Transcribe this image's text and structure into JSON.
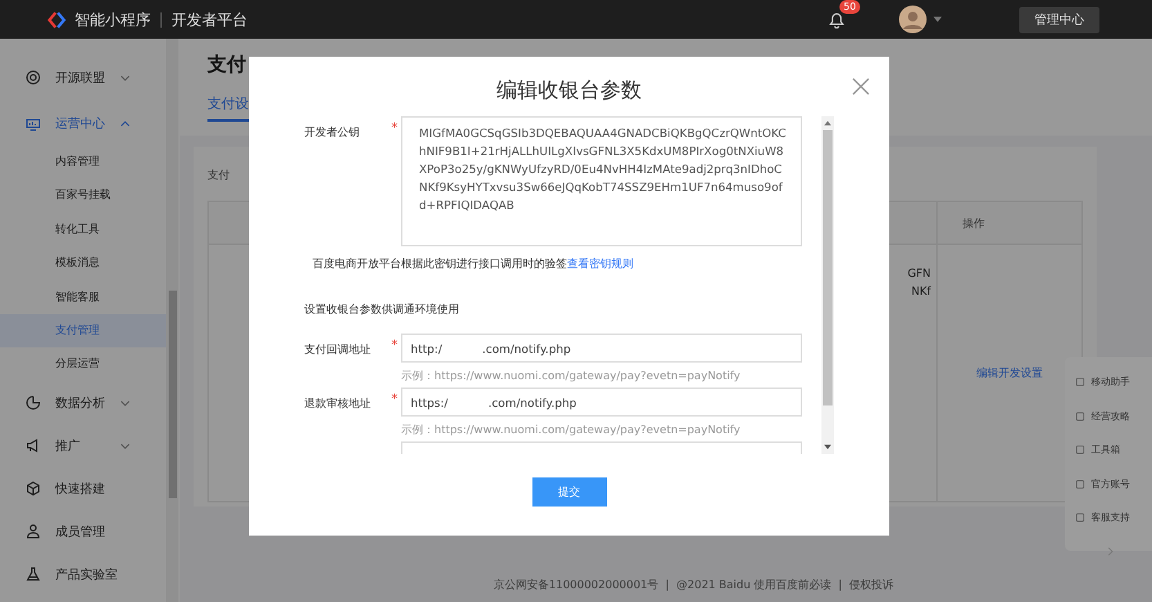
{
  "topbar": {
    "logo_text": "智能小程序",
    "platform": "开发者平台",
    "notification_badge": "50",
    "admin_button": "管理中心"
  },
  "sidebar": {
    "items": [
      {
        "label": "开源联盟",
        "expanded": false,
        "selected": false
      },
      {
        "label": "运营中心",
        "expanded": true,
        "selected": true,
        "children": [
          {
            "label": "内容管理",
            "selected": false
          },
          {
            "label": "百家号挂载",
            "selected": false
          },
          {
            "label": "转化工具",
            "selected": false
          },
          {
            "label": "模板消息",
            "selected": false
          },
          {
            "label": "智能客服",
            "selected": false
          },
          {
            "label": "支付管理",
            "selected": true
          },
          {
            "label": "分层运营",
            "selected": false
          }
        ]
      },
      {
        "label": "数据分析",
        "expanded": false,
        "selected": false
      },
      {
        "label": "推广",
        "expanded": false,
        "selected": false
      },
      {
        "label": "快速搭建",
        "selected": false
      },
      {
        "label": "成员管理",
        "selected": false
      },
      {
        "label": "产品实验室",
        "selected": false
      }
    ]
  },
  "main": {
    "title": "支付",
    "tab": "支付设",
    "section_label": "支付",
    "table": {
      "header": "操作",
      "fragment_lines": [
        "GFN",
        "NKf"
      ],
      "action_link": "编辑开发设置"
    }
  },
  "side_panel": {
    "items": [
      "移动助手",
      "经营攻略",
      "工具箱",
      "官方账号",
      "客服支持"
    ]
  },
  "footer": "京公网安备11000002000001号  |  @2021 Baidu 使用百度前必读  |  侵权投诉",
  "modal": {
    "title": "编辑收银台参数",
    "submit": "提交",
    "items": [
      {
        "kind": "textarea",
        "label": "开发者公钥",
        "required_mark": "*",
        "value": "MIGfMA0GCSqGSIb3DQEBAQUAA4GNADCBiQKBgQCzrQWntOKChNIF9B1I+21rHjALLhUILgXIvsGFNL3X5KdxUM8PIrXog0tNXiuW8XPoP3o25y/gKNWyUfzyRD/0Eu4NvHH4IzMAte9adj2prq3nIDhoCNKf9KsyHYTxvsu3Sw66eJQqKobT74SSZ9EHm1UF7n64muso9ofd+RPFIQIDAQAB"
      },
      {
        "kind": "hint",
        "text": "百度电商开放平台根据此密钥进行接口调用时的验签",
        "link": "查看密钥规则"
      },
      {
        "kind": "note",
        "text": "设置收银台参数供调通环境使用"
      },
      {
        "kind": "input",
        "label": "支付回调地址",
        "required_mark": "*",
        "value": "http:/           .com/notify.php",
        "example": "示例：https://www.nuomi.com/gateway/pay?evetn=payNotify"
      },
      {
        "kind": "input",
        "label": "退款审核地址",
        "required_mark": "*",
        "value": "https:/           .com/notify.php",
        "example": "示例：https://www.nuomi.com/gateway/pay?evetn=payNotify"
      }
    ]
  }
}
